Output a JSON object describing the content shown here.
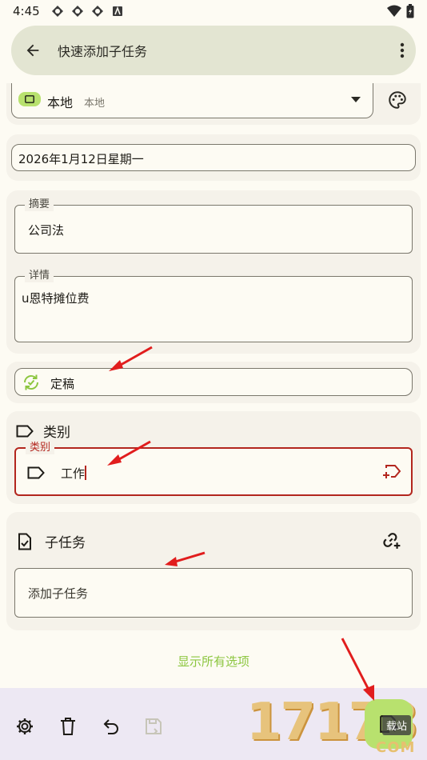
{
  "status": {
    "time": "4:45"
  },
  "topbar": {
    "title": "快速添加子任务"
  },
  "collection": {
    "name": "本地",
    "sub": "本地"
  },
  "date": {
    "value": "2026年1月12日星期一"
  },
  "summary": {
    "label": "摘要",
    "value": "公司法"
  },
  "details": {
    "label": "详情",
    "value": "u恩特摊位费"
  },
  "status_field": {
    "label": "定稿"
  },
  "categories": {
    "header": "类别",
    "field_label": "类别",
    "value": "工作"
  },
  "subtasks": {
    "header": "子任务",
    "placeholder": "添加子任务"
  },
  "show_all": {
    "label": "显示所有选项"
  },
  "watermark": {
    "digits": "17178",
    "badge": "载站",
    "sub": "COM"
  },
  "colors": {
    "accent_green": "#b8e16e",
    "error_red": "#b3261e",
    "status_green": "#8cc63f"
  }
}
